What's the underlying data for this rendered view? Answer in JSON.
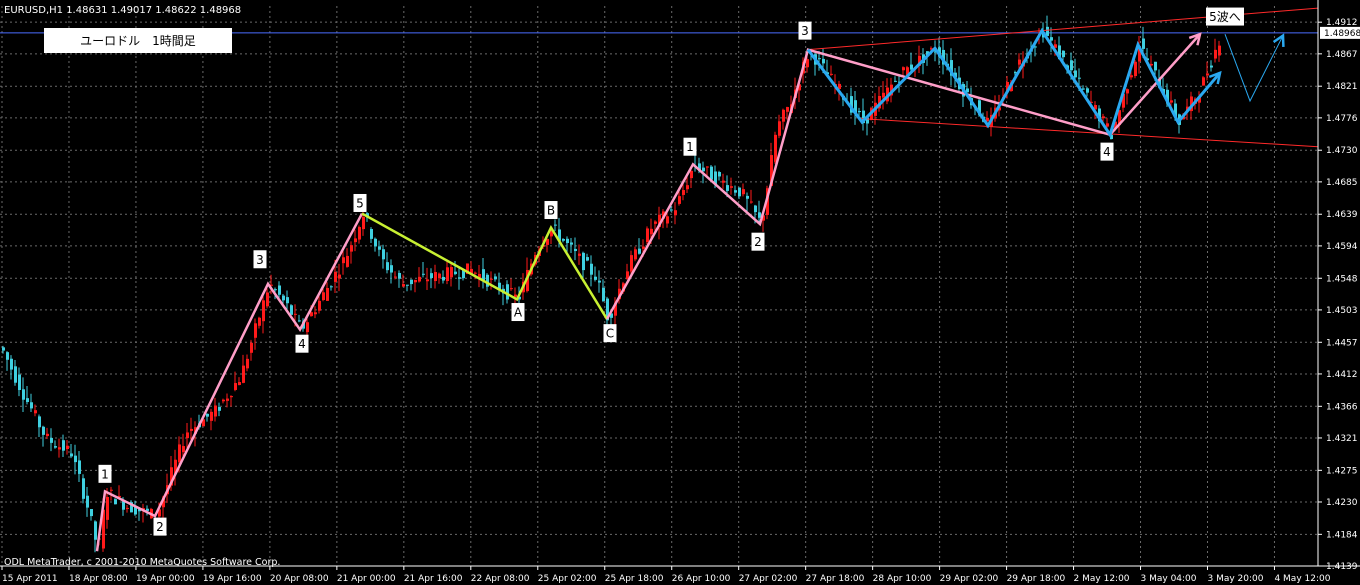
{
  "header": {
    "symbol_label": "EURUSD,H1  1.48631 1.49017 1.48622 1.48968",
    "title_box": "ユーロドル　1時間足"
  },
  "footer": {
    "copyright": "ODL MetaTrader, c 2001-2010 MetaQuotes Software Corp."
  },
  "current_price_label": "1.48968",
  "colors": {
    "background": "#000000",
    "grid": "#6a6a6a",
    "axis_text": "#ffffff",
    "bull_candle": "#ff1a1a",
    "bear_candle": "#3fd0e0",
    "impulse_wave": "#ff9ec8",
    "correction_wave": "#c8f032",
    "triangle_wave": "#2aa8f0",
    "channel": "#ff2a2a",
    "price_line": "#4a6cff"
  },
  "chart_data": {
    "type": "candlestick",
    "x_tick_labels": [
      "15 Apr 2011",
      "18 Apr 08:00",
      "19 Apr 00:00",
      "19 Apr 16:00",
      "20 Apr 08:00",
      "21 Apr 00:00",
      "21 Apr 16:00",
      "22 Apr 08:00",
      "25 Apr 02:00",
      "25 Apr 18:00",
      "26 Apr 10:00",
      "27 Apr 02:00",
      "27 Apr 18:00",
      "28 Apr 10:00",
      "29 Apr 02:00",
      "29 Apr 18:00",
      "2 May 12:00",
      "3 May 04:00",
      "3 May 20:00",
      "4 May 12:00"
    ],
    "y_tick_labels": [
      "1.4912",
      "1.4867",
      "1.4821",
      "1.4776",
      "1.4730",
      "1.4685",
      "1.4639",
      "1.4594",
      "1.4548",
      "1.4503",
      "1.4457",
      "1.4412",
      "1.4366",
      "1.4321",
      "1.4275",
      "1.4230",
      "1.4184",
      "1.4139"
    ],
    "ylim": [
      1.4139,
      1.4935
    ],
    "current_price": 1.48968,
    "price_path": [
      [
        0,
        1.445
      ],
      [
        20,
        1.439
      ],
      [
        45,
        1.432
      ],
      [
        70,
        1.43
      ],
      [
        85,
        1.423
      ],
      [
        97,
        1.416
      ],
      [
        105,
        1.4245
      ],
      [
        125,
        1.4225
      ],
      [
        155,
        1.421
      ],
      [
        185,
        1.433
      ],
      [
        215,
        1.436
      ],
      [
        240,
        1.441
      ],
      [
        268,
        1.454
      ],
      [
        285,
        1.451
      ],
      [
        300,
        1.4475
      ],
      [
        320,
        1.452
      ],
      [
        345,
        1.458
      ],
      [
        362,
        1.464
      ],
      [
        380,
        1.4575
      ],
      [
        400,
        1.454
      ],
      [
        430,
        1.455
      ],
      [
        470,
        1.456
      ],
      [
        517,
        1.4518
      ],
      [
        535,
        1.459
      ],
      [
        551,
        1.462
      ],
      [
        575,
        1.458
      ],
      [
        595,
        1.455
      ],
      [
        607,
        1.449
      ],
      [
        625,
        1.456
      ],
      [
        650,
        1.462
      ],
      [
        675,
        1.465
      ],
      [
        693,
        1.471
      ],
      [
        715,
        1.469
      ],
      [
        740,
        1.467
      ],
      [
        760,
        1.4625
      ],
      [
        775,
        1.476
      ],
      [
        790,
        1.48
      ],
      [
        808,
        1.4873
      ],
      [
        830,
        1.483
      ],
      [
        862,
        1.477
      ],
      [
        900,
        1.484
      ],
      [
        935,
        1.4875
      ],
      [
        960,
        1.482
      ],
      [
        988,
        1.4765
      ],
      [
        1015,
        1.485
      ],
      [
        1042,
        1.49
      ],
      [
        1075,
        1.483
      ],
      [
        1110,
        1.4752
      ],
      [
        1138,
        1.488
      ],
      [
        1160,
        1.482
      ],
      [
        1178,
        1.477
      ],
      [
        1200,
        1.482
      ],
      [
        1220,
        1.4895
      ]
    ],
    "waves": {
      "impulse_1_to_5": {
        "points": [
          [
            97,
            1.416
          ],
          [
            105,
            1.4245
          ],
          [
            155,
            1.421
          ],
          [
            268,
            1.454
          ],
          [
            300,
            1.4475
          ],
          [
            362,
            1.464
          ]
        ],
        "labels": [
          {
            "text": "1",
            "x": 105,
            "y": 1.427
          },
          {
            "text": "2",
            "x": 160,
            "y": 1.4195
          },
          {
            "text": "3",
            "x": 260,
            "y": 1.4575
          },
          {
            "text": "4",
            "x": 302,
            "y": 1.4455
          },
          {
            "text": "5",
            "x": 360,
            "y": 1.4655
          }
        ]
      },
      "abc_correction": {
        "points": [
          [
            362,
            1.464
          ],
          [
            517,
            1.4518
          ],
          [
            551,
            1.462
          ],
          [
            607,
            1.449
          ]
        ],
        "labels": [
          {
            "text": "A",
            "x": 518,
            "y": 1.45
          },
          {
            "text": "B",
            "x": 551,
            "y": 1.4645
          },
          {
            "text": "C",
            "x": 610,
            "y": 1.447
          }
        ]
      },
      "impulse_second": {
        "points": [
          [
            607,
            1.449
          ],
          [
            693,
            1.471
          ],
          [
            760,
            1.4625
          ],
          [
            808,
            1.4873
          ],
          [
            1110,
            1.4752
          ],
          [
            1200,
            1.4895
          ]
        ],
        "labels": [
          {
            "text": "1",
            "x": 690,
            "y": 1.4735
          },
          {
            "text": "2",
            "x": 758,
            "y": 1.46
          },
          {
            "text": "3",
            "x": 805,
            "y": 1.49
          },
          {
            "text": "4",
            "x": 1107,
            "y": 1.4728
          },
          {
            "text": "5波へ",
            "x": 1225,
            "y": 1.492
          }
        ]
      },
      "triangle": {
        "points": [
          [
            808,
            1.4873
          ],
          [
            862,
            1.477
          ],
          [
            935,
            1.4875
          ],
          [
            988,
            1.4765
          ],
          [
            1042,
            1.49
          ],
          [
            1110,
            1.4752
          ],
          [
            1138,
            1.488
          ],
          [
            1178,
            1.477
          ],
          [
            1220,
            1.484
          ]
        ]
      },
      "projection": {
        "points": [
          [
            1225,
            1.4895
          ],
          [
            1250,
            1.48
          ],
          [
            1283,
            1.4893
          ]
        ]
      },
      "channel_upper": [
        [
          808,
          1.4873
        ],
        [
          1318,
          1.4932
        ]
      ],
      "channel_lower": [
        [
          860,
          1.4775
        ],
        [
          1318,
          1.4735
        ]
      ]
    }
  }
}
